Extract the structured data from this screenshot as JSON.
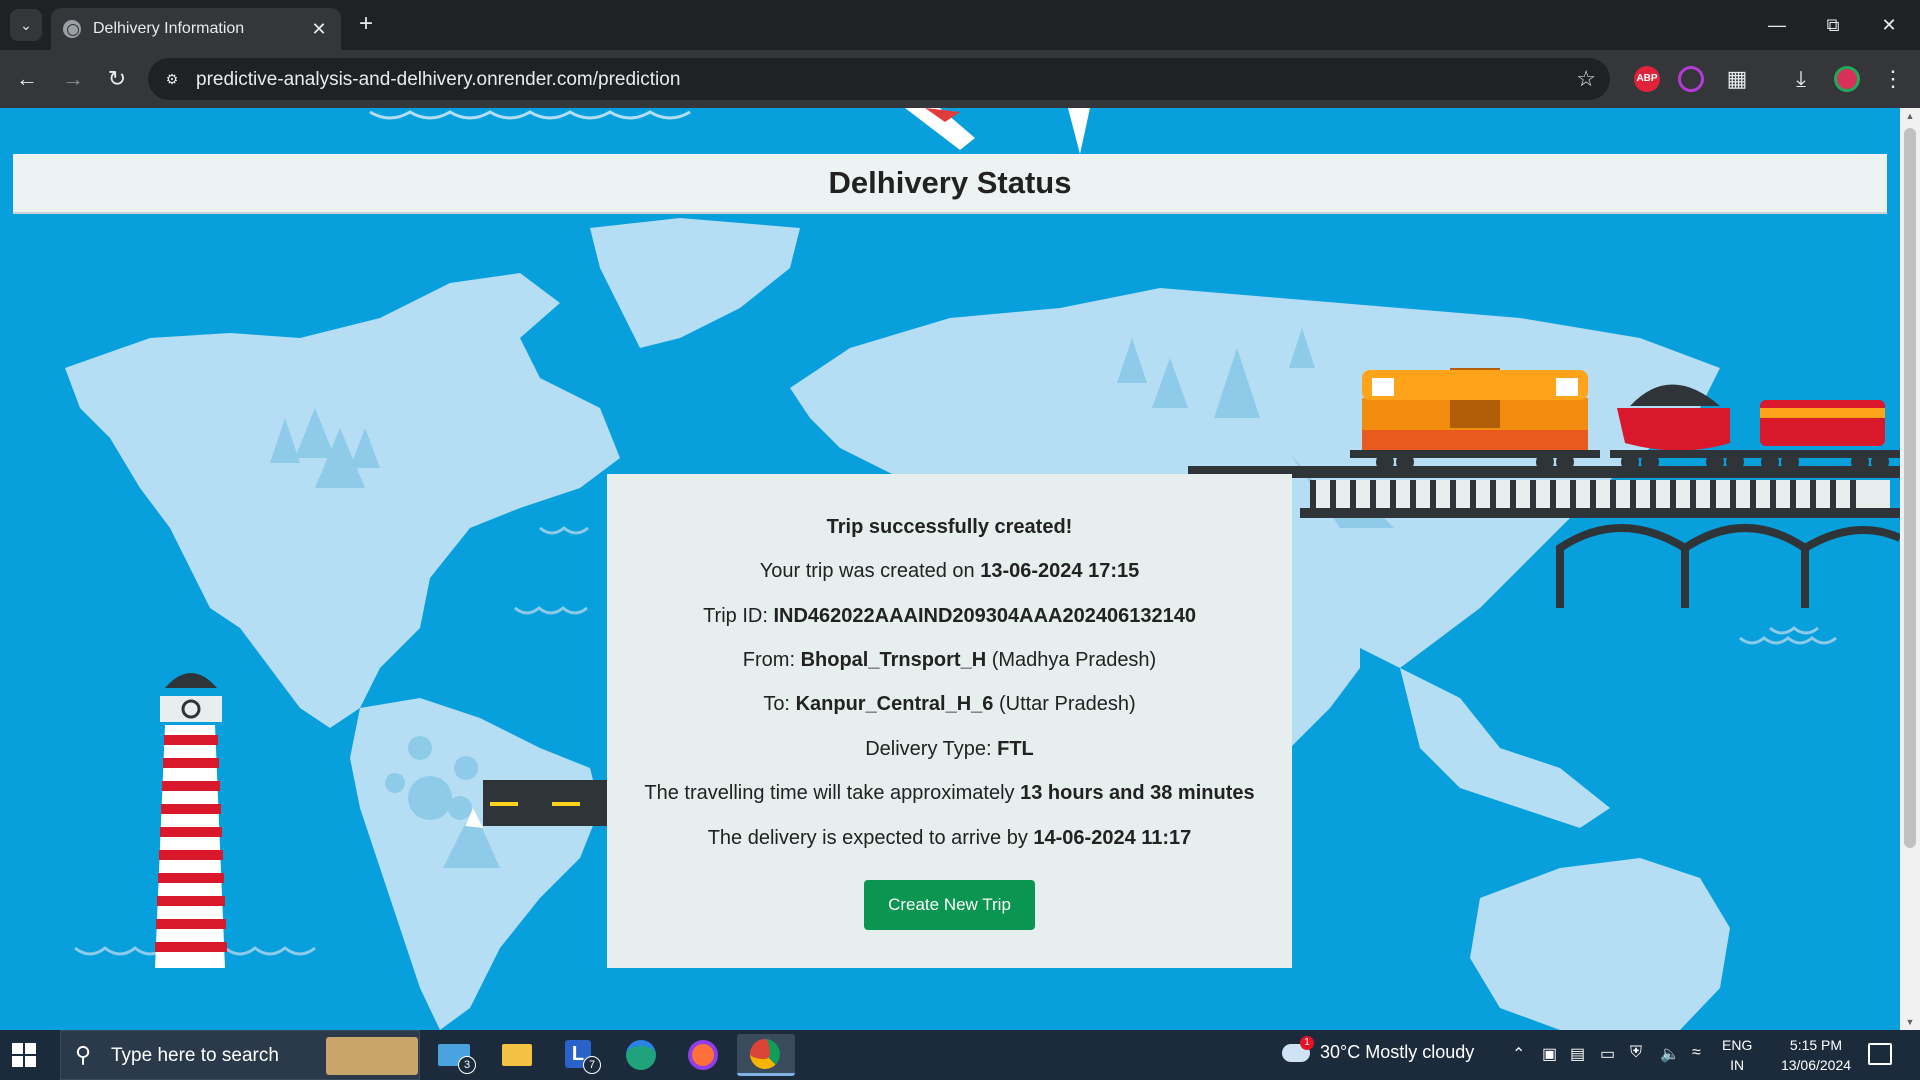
{
  "browser": {
    "tab_title": "Delhivery Information",
    "url": "predictive-analysis-and-delhivery.onrender.com/prediction",
    "extensions": [
      "ABP"
    ]
  },
  "page": {
    "header_title": "Delhivery Status",
    "status": {
      "heading": "Trip successfully created!",
      "created_prefix": "Your trip was created on ",
      "created_on": "13-06-2024 17:15",
      "trip_id_label": "Trip ID: ",
      "trip_id": "IND462022AAAIND209304AAA202406132140",
      "from_label": "From: ",
      "from_center": "Bhopal_Trnsport_H",
      "from_state": " (Madhya Pradesh)",
      "to_label": "To: ",
      "to_center": "Kanpur_Central_H_6",
      "to_state": " (Uttar Pradesh)",
      "delivery_type_label": "Delivery Type: ",
      "delivery_type": "FTL",
      "travel_prefix": "The travelling time will take approximately ",
      "travel_time": "13 hours and 38 minutes",
      "arrival_prefix": "The delivery is expected to arrive by ",
      "arrival": "14-06-2024 11:17",
      "button_label": "Create New Trip"
    }
  },
  "taskbar": {
    "search_placeholder": "Type here to search",
    "mail_badge": "3",
    "l_app_badge": "7",
    "weather_badge": "1",
    "weather": "30°C  Mostly cloudy",
    "lang_top": "ENG",
    "lang_bottom": "IN",
    "time": "5:15 PM",
    "date": "13/06/2024"
  },
  "colors": {
    "page_background": "#07a0dc",
    "continents": "#b5def4",
    "button": "#0a9550"
  }
}
